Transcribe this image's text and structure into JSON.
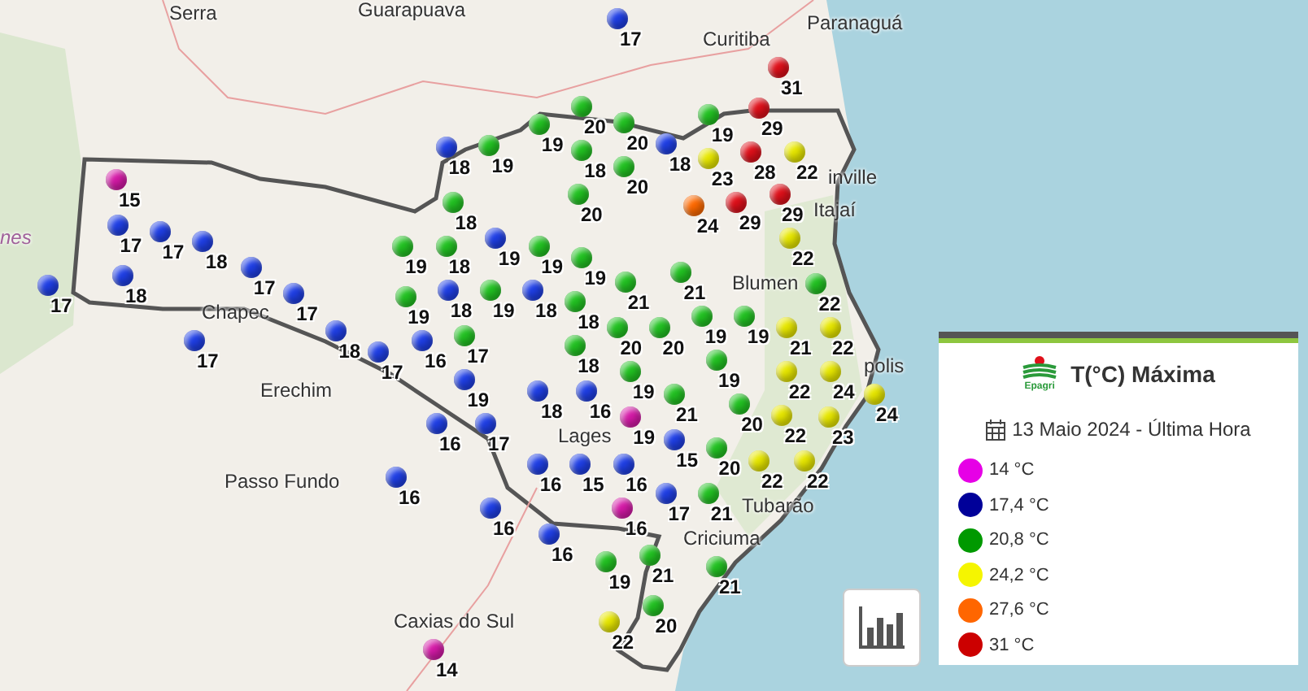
{
  "map": {
    "place_labels": [
      {
        "text": "Serra"
      },
      {
        "text": "Guarapuava"
      },
      {
        "text": "Curitiba"
      },
      {
        "text": "Paranaguá"
      },
      {
        "text": "nes"
      },
      {
        "text": "Chapec"
      },
      {
        "text": "Erechim"
      },
      {
        "text": "Passo Fundo"
      },
      {
        "text": "Caxias do Sul"
      },
      {
        "text": "Lages"
      },
      {
        "text": "Blumen"
      },
      {
        "text": "Itajaí"
      },
      {
        "text": "inville"
      },
      {
        "text": "polis"
      },
      {
        "text": "Tubarão"
      },
      {
        "text": "Criciuma"
      }
    ],
    "markers": [
      {
        "value": "17",
        "color": "#1f3fe6"
      },
      {
        "value": "31",
        "color": "#e0101a"
      },
      {
        "value": "29",
        "color": "#e0101a"
      },
      {
        "value": "18",
        "color": "#1f3fe6"
      },
      {
        "value": "19",
        "color": "#22c322"
      },
      {
        "value": "19",
        "color": "#22c322"
      },
      {
        "value": "20",
        "color": "#22c322"
      },
      {
        "value": "20",
        "color": "#22c322"
      },
      {
        "value": "20",
        "color": "#22c322"
      },
      {
        "value": "18",
        "color": "#22c322"
      },
      {
        "value": "20",
        "color": "#22c322"
      },
      {
        "value": "19",
        "color": "#22c322"
      },
      {
        "value": "18",
        "color": "#1f3fe6"
      },
      {
        "value": "23",
        "color": "#e8e800"
      },
      {
        "value": "24",
        "color": "#ff6a00"
      },
      {
        "value": "29",
        "color": "#e0101a"
      },
      {
        "value": "28",
        "color": "#e0101a"
      },
      {
        "value": "29",
        "color": "#e0101a"
      },
      {
        "value": "22",
        "color": "#e8e800"
      },
      {
        "value": "15",
        "color": "#d61aa8"
      },
      {
        "value": "17",
        "color": "#1f3fe6"
      },
      {
        "value": "17",
        "color": "#1f3fe6"
      },
      {
        "value": "18",
        "color": "#1f3fe6"
      },
      {
        "value": "17",
        "color": "#1f3fe6"
      },
      {
        "value": "18",
        "color": "#1f3fe6"
      },
      {
        "value": "17",
        "color": "#1f3fe6"
      },
      {
        "value": "17",
        "color": "#1f3fe6"
      },
      {
        "value": "17",
        "color": "#1f3fe6"
      },
      {
        "value": "18",
        "color": "#1f3fe6"
      },
      {
        "value": "17",
        "color": "#1f3fe6"
      },
      {
        "value": "19",
        "color": "#22c322"
      },
      {
        "value": "18",
        "color": "#22c322"
      },
      {
        "value": "19",
        "color": "#1f3fe6"
      },
      {
        "value": "18",
        "color": "#22c322"
      },
      {
        "value": "19",
        "color": "#22c322"
      },
      {
        "value": "18",
        "color": "#1f3fe6"
      },
      {
        "value": "19",
        "color": "#22c322"
      },
      {
        "value": "16",
        "color": "#1f3fe6"
      },
      {
        "value": "19",
        "color": "#1f3fe6"
      },
      {
        "value": "17",
        "color": "#22c322"
      },
      {
        "value": "19",
        "color": "#22c322"
      },
      {
        "value": "18",
        "color": "#1f3fe6"
      },
      {
        "value": "19",
        "color": "#22c322"
      },
      {
        "value": "16",
        "color": "#1f3fe6"
      },
      {
        "value": "16",
        "color": "#1f3fe6"
      },
      {
        "value": "17",
        "color": "#1f3fe6"
      },
      {
        "value": "16",
        "color": "#1f3fe6"
      },
      {
        "value": "16",
        "color": "#1f3fe6"
      },
      {
        "value": "14",
        "color": "#d61aa8"
      },
      {
        "value": "18",
        "color": "#1f3fe6"
      },
      {
        "value": "18",
        "color": "#22c322"
      },
      {
        "value": "18",
        "color": "#22c322"
      },
      {
        "value": "21",
        "color": "#22c322"
      },
      {
        "value": "21",
        "color": "#22c322"
      },
      {
        "value": "20",
        "color": "#22c322"
      },
      {
        "value": "20",
        "color": "#22c322"
      },
      {
        "value": "19",
        "color": "#22c322"
      },
      {
        "value": "19",
        "color": "#22c322"
      },
      {
        "value": "19",
        "color": "#22c322"
      },
      {
        "value": "22",
        "color": "#e8e800"
      },
      {
        "value": "22",
        "color": "#22c322"
      },
      {
        "value": "21",
        "color": "#e8e800"
      },
      {
        "value": "22",
        "color": "#e8e800"
      },
      {
        "value": "22",
        "color": "#e8e800"
      },
      {
        "value": "24",
        "color": "#e8e800"
      },
      {
        "value": "24",
        "color": "#e8e800"
      },
      {
        "value": "22",
        "color": "#e8e800"
      },
      {
        "value": "23",
        "color": "#e8e800"
      },
      {
        "value": "21",
        "color": "#22c322"
      },
      {
        "value": "19",
        "color": "#22c322"
      },
      {
        "value": "19",
        "color": "#d61aa8"
      },
      {
        "value": "16",
        "color": "#1f3fe6"
      },
      {
        "value": "15",
        "color": "#1f3fe6"
      },
      {
        "value": "16",
        "color": "#1f3fe6"
      },
      {
        "value": "16",
        "color": "#d61aa8"
      },
      {
        "value": "15",
        "color": "#1f3fe6"
      },
      {
        "value": "17",
        "color": "#1f3fe6"
      },
      {
        "value": "20",
        "color": "#22c322"
      },
      {
        "value": "22",
        "color": "#e8e800"
      },
      {
        "value": "20",
        "color": "#22c322"
      },
      {
        "value": "21",
        "color": "#22c322"
      },
      {
        "value": "21",
        "color": "#22c322"
      },
      {
        "value": "21",
        "color": "#22c322"
      },
      {
        "value": "19",
        "color": "#22c322"
      },
      {
        "value": "20",
        "color": "#22c322"
      },
      {
        "value": "22",
        "color": "#e8e800"
      },
      {
        "value": "16",
        "color": "#1f3fe6"
      },
      {
        "value": "22",
        "color": "#e8e800"
      }
    ]
  },
  "legend": {
    "logo_text": "Epagri",
    "title": "T(°C) Máxima",
    "date": "13 Maio 2024 - Última Hora",
    "items": [
      {
        "label": "14 °C",
        "color": "#e600e6"
      },
      {
        "label": "17,4 °C",
        "color": "#000099"
      },
      {
        "label": "20,8 °C",
        "color": "#009900"
      },
      {
        "label": "24,2 °C",
        "color": "#f5f500"
      },
      {
        "label": "27,6 °C",
        "color": "#ff6600"
      },
      {
        "label": "31 °C",
        "color": "#cc0000"
      }
    ]
  }
}
